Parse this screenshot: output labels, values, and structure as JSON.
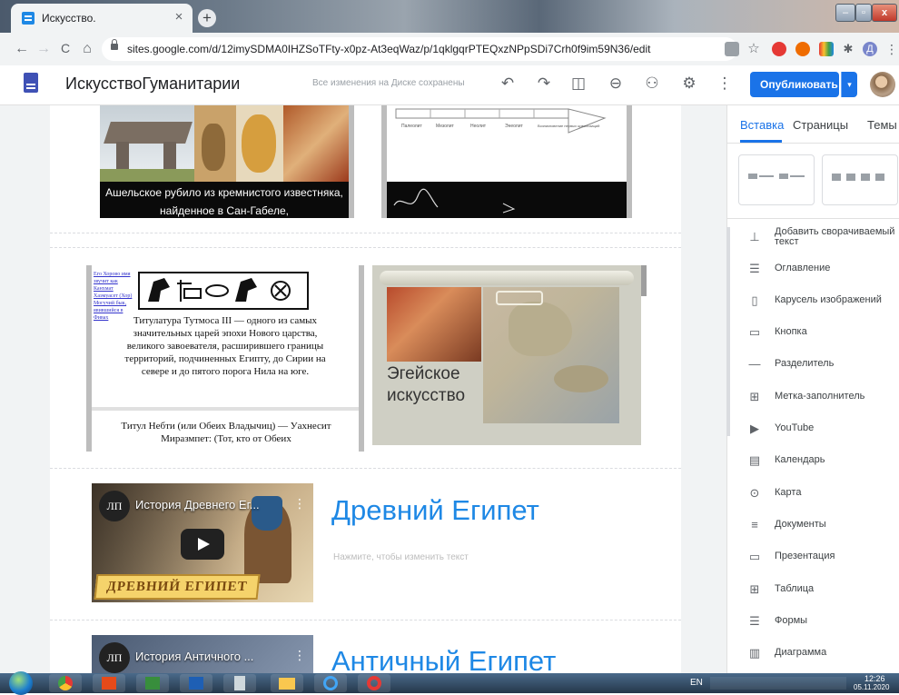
{
  "browser": {
    "tab_title": "Искусство.",
    "tab_close": "×",
    "new_tab": "+",
    "url": "sites.google.com/d/12imySDMA0IHZSoTFty-x0pz-At3eqWaz/p/1qklgqrPTEQxzNPpSDi7Crh0f9im59N36/edit",
    "nav": {
      "back": "←",
      "forward": "→",
      "reload": "C",
      "home": "⌂"
    },
    "window": {
      "minimize": "–",
      "maximize": "▫",
      "close": "x"
    },
    "ext_avatar_letter": "Д"
  },
  "sites": {
    "site_name": "ИскусствоГуманитарии",
    "saved_status": "Все изменения на Диске сохранены",
    "publish_label": "Опубликовать",
    "publish_dropdown": "▾",
    "toolbar": {
      "undo": "↶",
      "redo": "↷",
      "preview": "◫",
      "link": "⊖",
      "share": "⚇",
      "settings": "⚙",
      "more": "⋮"
    }
  },
  "content": {
    "img1_caption": "Ашельское рубило из кремнистого известняка, найденное в Сан-Габеле,",
    "timeline_labels": [
      "Палеолит",
      "Мезолит",
      "Неолит",
      "Энеолит",
      "Возникновение первых цивилизаций"
    ],
    "img3": {
      "side_note": "Его Хорово имя звучит как Канхмат Хаэмуасет (Хор) Могучий бык, явившийся в Фивах",
      "caption": "Титулатура Тутмоса III — одного из самых значительных царей эпохи Нового царства, великого завоевателя, расширившего границы территорий, подчиненных Египту, до Сирии на севере и до пятого порога Нила на юге.",
      "caption2": "Титул Небти (или Обеих Владычиц) — Уахнесит Миразмпет: (Тот, кто от Обеих"
    },
    "img4_title": "Эгейское искусство",
    "video1": {
      "channel": "ЛП",
      "title": "История Древнего Ег...",
      "menu": "⋮",
      "caption": "ДРЕВНИЙ ЕГИПЕТ"
    },
    "heading1": "Древний Египет",
    "placeholder": "Нажмите, чтобы изменить текст",
    "video2": {
      "channel": "ЛП",
      "title": "История Античного ...",
      "menu": "⋮"
    },
    "heading2": "Античный Египет"
  },
  "panel": {
    "tabs": [
      "Вставка",
      "Страницы",
      "Темы"
    ],
    "active_tab": "Вставка",
    "items": [
      {
        "label": "Добавить сворачиваемый текст",
        "icon": "collapsible-text-icon",
        "glyph": "⊥"
      },
      {
        "label": "Оглавление",
        "icon": "table-of-contents-icon",
        "glyph": "☰"
      },
      {
        "label": "Карусель изображений",
        "icon": "image-carousel-icon",
        "glyph": "▯"
      },
      {
        "label": "Кнопка",
        "icon": "button-icon",
        "glyph": "▭"
      },
      {
        "label": "Разделитель",
        "icon": "divider-icon",
        "glyph": "—"
      },
      {
        "label": "Метка-заполнитель",
        "icon": "placeholder-icon",
        "glyph": "⊞"
      },
      {
        "label": "YouTube",
        "icon": "youtube-icon",
        "glyph": "▶"
      },
      {
        "label": "Календарь",
        "icon": "calendar-icon",
        "glyph": "▤"
      },
      {
        "label": "Карта",
        "icon": "map-pin-icon",
        "glyph": "⊙"
      },
      {
        "label": "Документы",
        "icon": "docs-icon",
        "glyph": "≡"
      },
      {
        "label": "Презентация",
        "icon": "slides-icon",
        "glyph": "▭"
      },
      {
        "label": "Таблица",
        "icon": "sheets-icon",
        "glyph": "⊞"
      },
      {
        "label": "Формы",
        "icon": "forms-icon",
        "glyph": "☰"
      },
      {
        "label": "Диаграмма",
        "icon": "chart-icon",
        "glyph": "▥"
      }
    ]
  },
  "taskbar": {
    "lang": "EN",
    "time": "12:26",
    "date": "05.11.2020"
  },
  "colors": {
    "accent": "#1a73e8",
    "heading": "#1e88e5",
    "text": "#3c4043"
  }
}
